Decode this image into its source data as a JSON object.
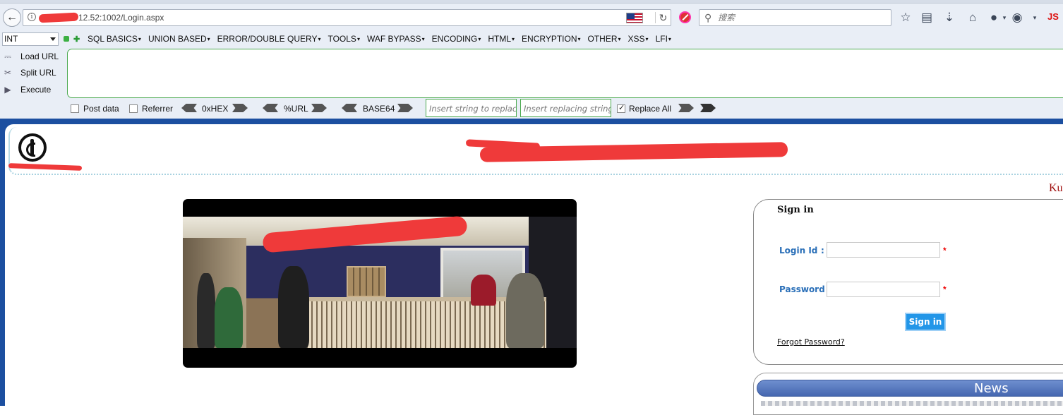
{
  "browser": {
    "url_visible": "12.52:1002/Login.aspx",
    "search_placeholder": "搜索",
    "js_label": "JS"
  },
  "hackbar": {
    "select_value": "INT",
    "menu": [
      "SQL BASICS",
      "UNION BASED",
      "ERROR/DOUBLE QUERY",
      "TOOLS",
      "WAF BYPASS",
      "ENCODING",
      "HTML",
      "ENCRYPTION",
      "OTHER",
      "XSS",
      "LFI"
    ],
    "load_url": "Load URL",
    "split_url": "Split URL",
    "execute": "Execute",
    "post_data": "Post data",
    "referrer": "Referrer",
    "hex": "0xHEX",
    "url_enc": "%URL",
    "base64": "BASE64",
    "replace_placeholder": "Insert string to replace",
    "replacing_placeholder": "Insert replacing string",
    "replace_all": "Replace All",
    "post_data_checked": false,
    "referrer_checked": false,
    "replace_all_checked": true
  },
  "page": {
    "marquee": "Ku",
    "signin": {
      "title": "Sign in",
      "login_label": "Login Id",
      "login_colon": ":",
      "password_label": "Password :",
      "required_mark": "*",
      "button": "Sign in",
      "forgot": "Forgot Password?"
    },
    "news_title": "News"
  },
  "colors": {
    "page_blue": "#1c4fa0",
    "label_blue": "#2a6fb8",
    "button_blue": "#2296e8",
    "redaction_red": "#ef3a3a",
    "hackbar_green": "#4caa50"
  }
}
